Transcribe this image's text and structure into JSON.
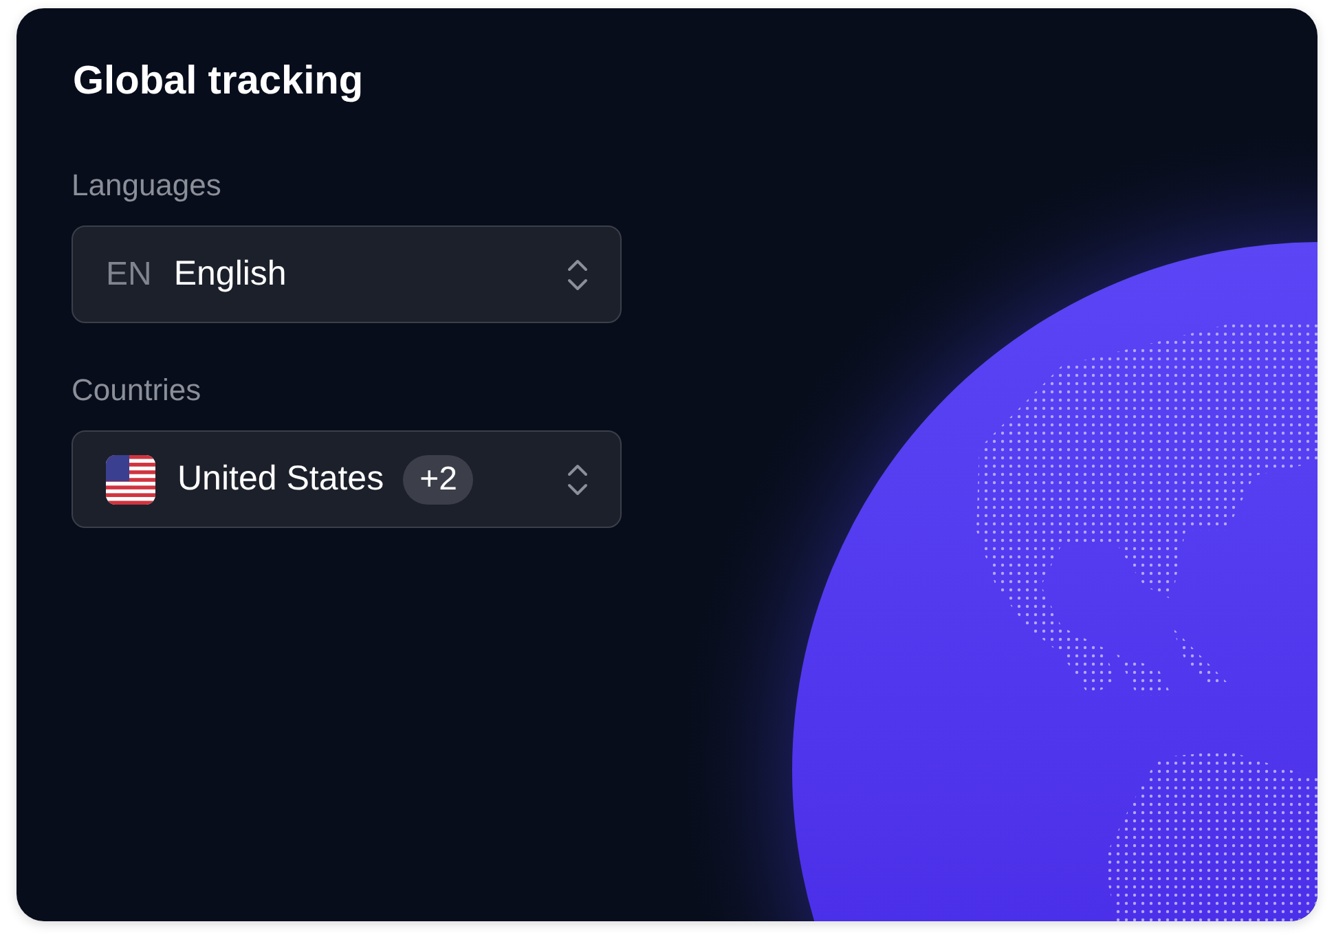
{
  "title": "Global tracking",
  "fields": [
    {
      "kind": "language",
      "label": "Languages",
      "code": "EN",
      "value": "English"
    },
    {
      "kind": "country",
      "label": "Countries",
      "value": "United States",
      "extra_count": "+2"
    }
  ]
}
